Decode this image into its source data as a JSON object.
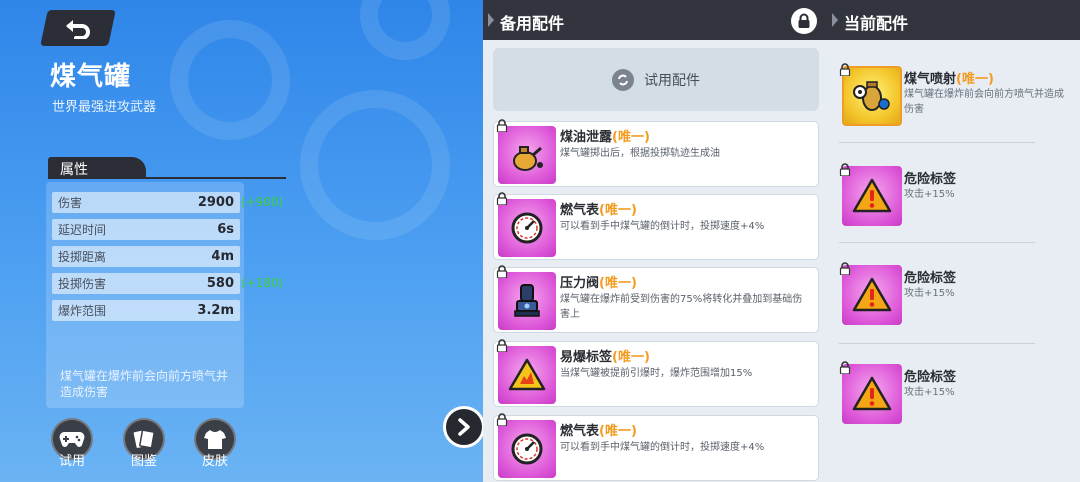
{
  "left": {
    "item_name": "煤气罐",
    "item_subtitle": "世界最强进攻武器",
    "stats_tab": "属性",
    "stats": [
      {
        "label": "伤害",
        "value": "2900",
        "bonus": "(+900)"
      },
      {
        "label": "延迟时间",
        "value": "6s",
        "bonus": ""
      },
      {
        "label": "投掷距离",
        "value": "4m",
        "bonus": ""
      },
      {
        "label": "投掷伤害",
        "value": "580",
        "bonus": "(+180)"
      },
      {
        "label": "爆炸范围",
        "value": "3.2m",
        "bonus": ""
      }
    ],
    "description": "煤气罐在爆炸前会向前方喷气并造成伤害",
    "buttons": {
      "try": "试用",
      "gallery": "图鉴",
      "skin": "皮肤"
    }
  },
  "spare": {
    "title": "备用配件",
    "try_label": "试用配件",
    "cards": [
      {
        "name": "煤油泄露",
        "tag": "(唯一)",
        "desc": "煤气罐掷出后，根据投掷轨迹生成油",
        "icon": "oil-can-icon"
      },
      {
        "name": "燃气表",
        "tag": "(唯一)",
        "desc": "可以看到手中煤气罐的倒计时，投掷速度+4%",
        "icon": "gauge-icon"
      },
      {
        "name": "压力阀",
        "tag": "(唯一)",
        "desc": "煤气罐在爆炸前受到伤害的75%将转化并叠加到基础伤害上",
        "icon": "valve-icon"
      },
      {
        "name": "易爆标签",
        "tag": "(唯一)",
        "desc": "当煤气罐被提前引爆时，爆炸范围增加15%",
        "icon": "explosive-label-icon"
      },
      {
        "name": "燃气表",
        "tag": "(唯一)",
        "desc": "可以看到手中煤气罐的倒计时，投掷速度+4%",
        "icon": "gauge-icon"
      }
    ]
  },
  "current": {
    "title": "当前配件",
    "items": [
      {
        "name": "煤气喷射",
        "tag": "(唯一)",
        "desc": "煤气罐在爆炸前会向前方喷气并造成伤害",
        "icon": "gas-jet-icon"
      },
      {
        "name": "危险标签",
        "tag": "",
        "desc": "攻击+15%",
        "icon": "warning-icon"
      },
      {
        "name": "危险标签",
        "tag": "",
        "desc": "攻击+15%",
        "icon": "warning-icon"
      },
      {
        "name": "危险标签",
        "tag": "",
        "desc": "攻击+15%",
        "icon": "warning-icon"
      }
    ]
  },
  "colors": {
    "accent_orange": "#f29b1f",
    "bonus_green": "#3ad23a",
    "card_magenta": "#dc55d7",
    "dark_header": "#32353d"
  }
}
